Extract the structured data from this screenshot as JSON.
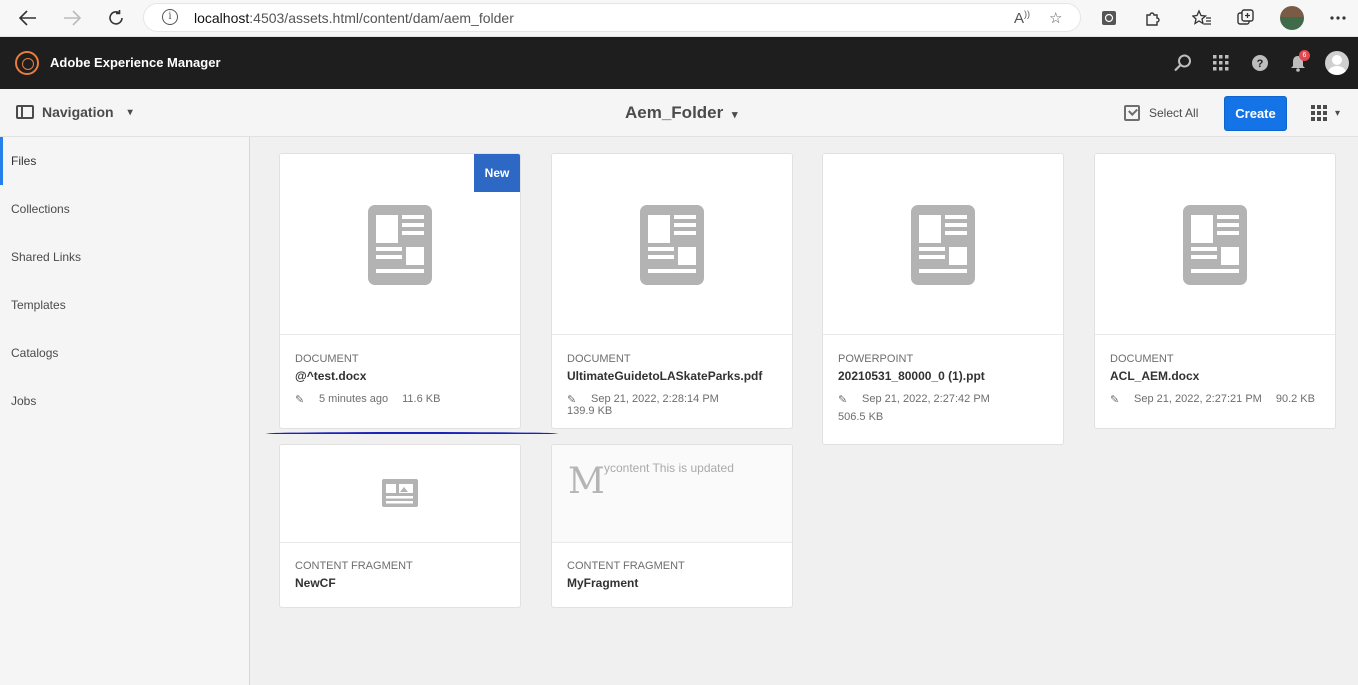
{
  "browser": {
    "url_host": "localhost",
    "url_rest": ":4503/assets.html/content/dam/aem_folder"
  },
  "header": {
    "app_title": "Adobe Experience Manager",
    "notification_count": "6"
  },
  "actionbar": {
    "navigation_label": "Navigation",
    "folder_title": "Aem_Folder",
    "select_all_label": "Select All",
    "create_label": "Create"
  },
  "sidebar": {
    "items": [
      {
        "label": "Files"
      },
      {
        "label": "Collections"
      },
      {
        "label": "Shared Links"
      },
      {
        "label": "Templates"
      },
      {
        "label": "Catalogs"
      },
      {
        "label": "Jobs"
      }
    ]
  },
  "cards": [
    {
      "type": "DOCUMENT",
      "name": "@^test.docx",
      "modified": "5 minutes ago",
      "size": "11.6 KB",
      "badge": "New"
    },
    {
      "type": "DOCUMENT",
      "name": "UltimateGuidetoLASkateParks.pdf",
      "modified": "Sep 21, 2022, 2:28:14 PM",
      "size": "139.9 KB"
    },
    {
      "type": "POWERPOINT",
      "name": "20210531_80000_0 (1).ppt",
      "modified": "Sep 21, 2022, 2:27:42 PM",
      "size": "506.5 KB"
    },
    {
      "type": "DOCUMENT",
      "name": "ACL_AEM.docx",
      "modified": "Sep 21, 2022, 2:27:21 PM",
      "size": "90.2 KB"
    },
    {
      "type": "CONTENT FRAGMENT",
      "name": "NewCF"
    },
    {
      "type": "CONTENT FRAGMENT",
      "name": "MyFragment",
      "preview_initial": "M",
      "preview_text": "ycontent This is updated"
    }
  ],
  "colors": {
    "accent": "#1473e6",
    "header_bg": "#1e1e1e",
    "new_badge": "#2d68c4",
    "annotation_underline": "#1a22b8"
  }
}
